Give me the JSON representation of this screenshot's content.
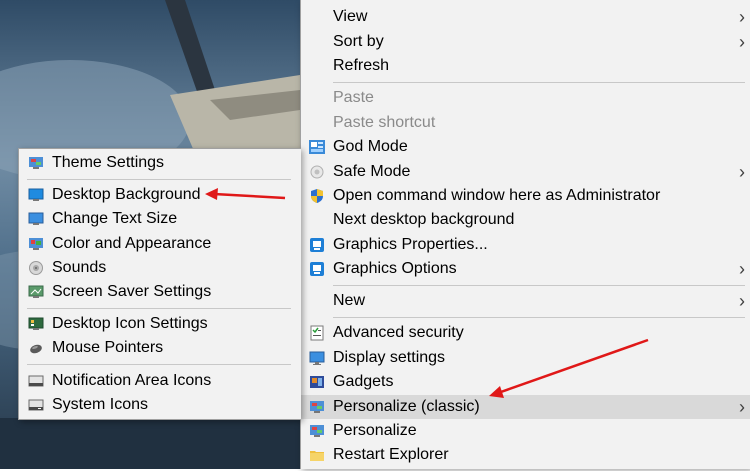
{
  "main_menu": {
    "items": [
      {
        "label": "View",
        "submenu": true
      },
      {
        "label": "Sort by",
        "submenu": true
      },
      {
        "label": "Refresh"
      },
      {
        "label": "Paste",
        "disabled": true
      },
      {
        "label": "Paste shortcut",
        "disabled": true
      },
      {
        "label": "God Mode",
        "icon": "control-panel-icon"
      },
      {
        "label": "Safe Mode",
        "icon": "safe-mode-icon",
        "submenu": true
      },
      {
        "label": "Open command window here as Administrator",
        "icon": "uac-shield-icon"
      },
      {
        "label": "Next desktop background"
      },
      {
        "label": "Graphics Properties...",
        "icon": "graphics-icon"
      },
      {
        "label": "Graphics Options",
        "icon": "graphics-icon",
        "submenu": true
      },
      {
        "label": "New",
        "submenu": true
      },
      {
        "label": "Advanced security",
        "icon": "security-icon"
      },
      {
        "label": "Display settings",
        "icon": "display-icon"
      },
      {
        "label": "Gadgets",
        "icon": "gadgets-icon"
      },
      {
        "label": "Personalize (classic)",
        "icon": "personalize-icon",
        "submenu": true,
        "highlighted": true
      },
      {
        "label": "Personalize",
        "icon": "personalize-icon"
      },
      {
        "label": "Restart Explorer",
        "icon": "folder-icon"
      }
    ]
  },
  "sub_menu": {
    "items": [
      {
        "label": "Theme Settings",
        "icon": "theme-icon"
      },
      {
        "label": "Desktop Background",
        "icon": "desktop-background-icon"
      },
      {
        "label": "Change Text Size",
        "icon": "monitor-icon"
      },
      {
        "label": "Color and Appearance",
        "icon": "color-icon"
      },
      {
        "label": "Sounds",
        "icon": "sounds-icon"
      },
      {
        "label": "Screen Saver Settings",
        "icon": "screensaver-icon"
      },
      {
        "label": "Desktop Icon Settings",
        "icon": "desktop-icon-settings-icon"
      },
      {
        "label": "Mouse Pointers",
        "icon": "mouse-icon"
      },
      {
        "label": "Notification Area Icons",
        "icon": "notification-icon"
      },
      {
        "label": "System Icons",
        "icon": "system-icons-icon"
      }
    ]
  },
  "colors": {
    "menu_bg": "#f2f2f2",
    "highlight_bg": "#d9d9d9",
    "disabled_text": "#8a8a8a",
    "annotation_arrow": "#e01818"
  }
}
